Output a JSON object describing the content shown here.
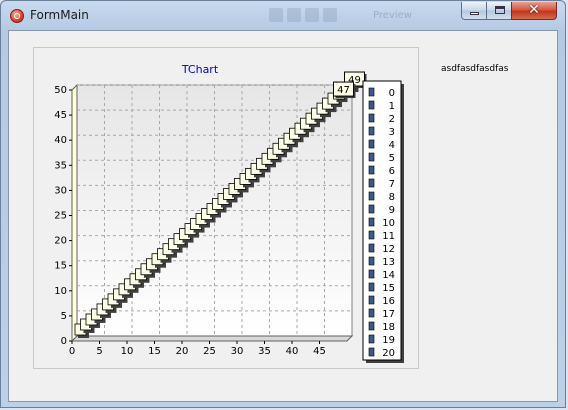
{
  "window": {
    "title": "FormMain",
    "background_title": "Preview",
    "close_glyph": "✕"
  },
  "side_label": "asdfasdfasdfas",
  "chart_data": {
    "type": "scatter",
    "title": "TChart",
    "xlabel": "",
    "ylabel": "",
    "xlim": [
      0,
      50
    ],
    "ylim": [
      0,
      50
    ],
    "x_ticks": [
      0,
      5,
      10,
      15,
      20,
      25,
      30,
      35,
      40,
      45
    ],
    "y_ticks": [
      0,
      5,
      10,
      15,
      20,
      25,
      30,
      35,
      40,
      45,
      50
    ],
    "grid": true,
    "three_d": true,
    "legend_position": "right",
    "points": [
      [
        0,
        0
      ],
      [
        1,
        1
      ],
      [
        2,
        2
      ],
      [
        3,
        3
      ],
      [
        4,
        4
      ],
      [
        5,
        5
      ],
      [
        6,
        6
      ],
      [
        7,
        7
      ],
      [
        8,
        8
      ],
      [
        9,
        9
      ],
      [
        10,
        10
      ],
      [
        11,
        11
      ],
      [
        12,
        12
      ],
      [
        13,
        13
      ],
      [
        14,
        14
      ],
      [
        15,
        15
      ],
      [
        16,
        16
      ],
      [
        17,
        17
      ],
      [
        18,
        18
      ],
      [
        19,
        19
      ],
      [
        20,
        20
      ],
      [
        21,
        21
      ],
      [
        22,
        22
      ],
      [
        23,
        23
      ],
      [
        24,
        24
      ],
      [
        25,
        25
      ],
      [
        26,
        26
      ],
      [
        27,
        27
      ],
      [
        28,
        28
      ],
      [
        29,
        29
      ],
      [
        30,
        30
      ],
      [
        31,
        31
      ],
      [
        32,
        32
      ],
      [
        33,
        33
      ],
      [
        34,
        34
      ],
      [
        35,
        35
      ],
      [
        36,
        36
      ],
      [
        37,
        37
      ],
      [
        38,
        38
      ],
      [
        39,
        39
      ],
      [
        40,
        40
      ],
      [
        41,
        41
      ],
      [
        42,
        42
      ],
      [
        43,
        43
      ],
      [
        44,
        44
      ],
      [
        45,
        45
      ],
      [
        46,
        46
      ],
      [
        47,
        47
      ],
      [
        48,
        48
      ],
      [
        49,
        49
      ]
    ],
    "visible_labels": [
      "49",
      "47"
    ],
    "legend_items": [
      "0",
      "1",
      "2",
      "3",
      "4",
      "5",
      "6",
      "7",
      "8",
      "9",
      "10",
      "11",
      "12",
      "13",
      "14",
      "15",
      "16",
      "17",
      "18",
      "19",
      "20"
    ],
    "colors": {
      "marker_fill": "#3a5a8c",
      "label_fill": "#ffffe8",
      "title_color": "#0000cc",
      "wall_fill": "#ffffd8",
      "back_wall_top": "#e8e8e8",
      "back_wall_bottom": "#ffffff"
    }
  }
}
